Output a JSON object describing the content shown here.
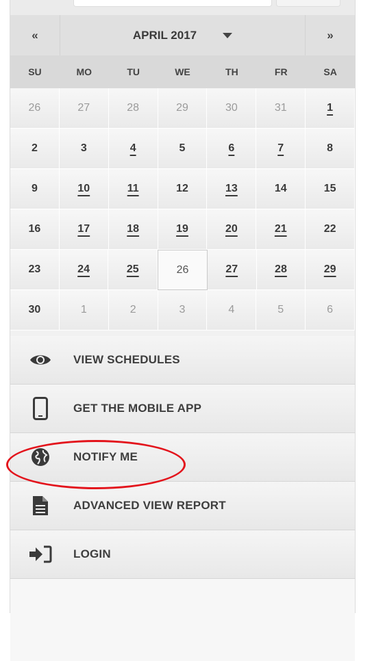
{
  "calendar": {
    "prev_label": "«",
    "next_label": "»",
    "month_label": "APRIL 2017",
    "weekdays": [
      "SU",
      "MO",
      "TU",
      "WE",
      "TH",
      "FR",
      "SA"
    ],
    "weeks": [
      [
        {
          "d": "26",
          "other": true
        },
        {
          "d": "27",
          "other": true
        },
        {
          "d": "28",
          "other": true
        },
        {
          "d": "29",
          "other": true
        },
        {
          "d": "30",
          "other": true
        },
        {
          "d": "31",
          "other": true
        },
        {
          "d": "1",
          "event": true
        }
      ],
      [
        {
          "d": "2"
        },
        {
          "d": "3"
        },
        {
          "d": "4",
          "event": true
        },
        {
          "d": "5"
        },
        {
          "d": "6",
          "event": true
        },
        {
          "d": "7",
          "event": true
        },
        {
          "d": "8"
        }
      ],
      [
        {
          "d": "9"
        },
        {
          "d": "10",
          "event": true
        },
        {
          "d": "11",
          "event": true
        },
        {
          "d": "12"
        },
        {
          "d": "13",
          "event": true
        },
        {
          "d": "14"
        },
        {
          "d": "15"
        }
      ],
      [
        {
          "d": "16"
        },
        {
          "d": "17",
          "event": true
        },
        {
          "d": "18",
          "event": true
        },
        {
          "d": "19",
          "event": true
        },
        {
          "d": "20",
          "event": true
        },
        {
          "d": "21",
          "event": true
        },
        {
          "d": "22"
        }
      ],
      [
        {
          "d": "23"
        },
        {
          "d": "24",
          "event": true
        },
        {
          "d": "25",
          "event": true
        },
        {
          "d": "26",
          "today": true
        },
        {
          "d": "27",
          "event": true
        },
        {
          "d": "28",
          "event": true
        },
        {
          "d": "29",
          "event": true
        }
      ],
      [
        {
          "d": "30"
        },
        {
          "d": "1",
          "other": true
        },
        {
          "d": "2",
          "other": true
        },
        {
          "d": "3",
          "other": true
        },
        {
          "d": "4",
          "other": true
        },
        {
          "d": "5",
          "other": true
        },
        {
          "d": "6",
          "other": true
        }
      ]
    ]
  },
  "menu": {
    "items": [
      {
        "label": "VIEW SCHEDULES",
        "icon": "eye-icon"
      },
      {
        "label": "GET THE MOBILE APP",
        "icon": "mobile-phone-icon"
      },
      {
        "label": "NOTIFY ME",
        "icon": "globe-icon"
      },
      {
        "label": "ADVANCED VIEW REPORT",
        "icon": "document-icon"
      },
      {
        "label": "LOGIN",
        "icon": "sign-in-icon"
      }
    ]
  },
  "annotation": {
    "color": "#e3141c",
    "target": "NOTIFY ME"
  }
}
